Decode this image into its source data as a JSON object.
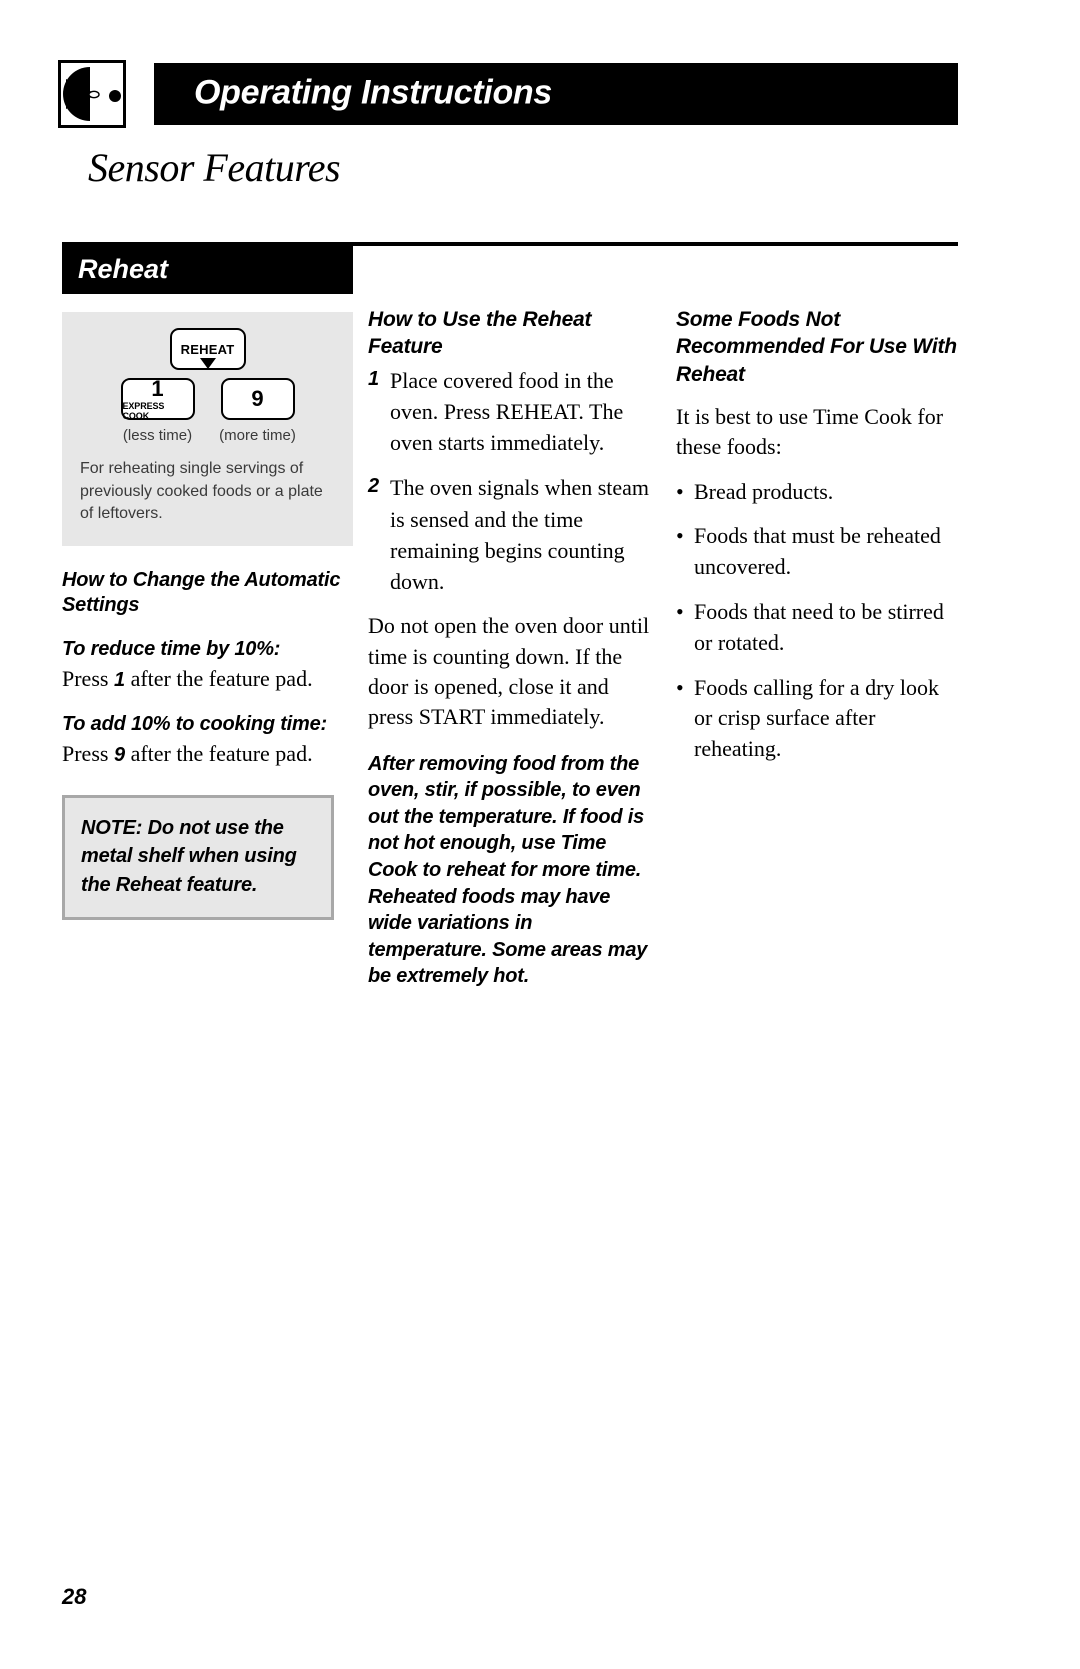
{
  "header": {
    "title": "Operating Instructions",
    "icon": "microwave-oven-icon",
    "section_title": "Sensor Features"
  },
  "feature_bar": {
    "label": "Reheat"
  },
  "control_panel": {
    "reheat_key": "REHEAT",
    "less_key_number": "1",
    "less_key_sublabel": "EXPRESS COOK",
    "more_key_number": "9",
    "less_caption": "(less time)",
    "more_caption": "(more time)",
    "description": "For reheating single servings of previously cooked foods or a plate of leftovers."
  },
  "left_column": {
    "heading": "How to Change the Automatic Settings",
    "reduce_heading": "To reduce time by 10%:",
    "reduce_press_prefix": "Press ",
    "reduce_press_key": "1",
    "reduce_press_suffix": " after the feature pad.",
    "add_heading": "To add 10% to cooking time:",
    "add_press_prefix": "Press ",
    "add_press_key": "9",
    "add_press_suffix": " after the feature pad.",
    "note": "NOTE: Do not use the metal shelf when using the Reheat feature."
  },
  "middle_column": {
    "heading": "How to Use the Reheat Feature",
    "steps": [
      {
        "number": "1",
        "text": "Place covered food in the oven. Press REHEAT. The oven starts immediately."
      },
      {
        "number": "2",
        "text": "The oven signals when steam is sensed and the time remaining begins counting down."
      }
    ],
    "paragraph": "Do not open the oven door until time is counting down. If the door is opened, close it and press START immediately.",
    "bold_paragraph": "After removing food from the oven, stir, if possible, to even out the temperature. If food is not hot enough, use Time Cook to reheat for more time. Reheated foods may have wide variations in temperature. Some areas may be extremely hot."
  },
  "right_column": {
    "heading": "Some Foods Not Recommended For Use With Reheat",
    "intro": "It is best to use Time Cook for these foods:",
    "bullet_marker": "•",
    "bullets": [
      "Bread products.",
      "Foods that must be reheated uncovered.",
      "Foods that need to be stirred or rotated.",
      "Foods calling for a dry look or crisp surface after reheating."
    ]
  },
  "footer": {
    "page_number": "28"
  },
  "colors": {
    "bar_black": "#000000",
    "panel_gray": "#e7e7e7",
    "note_border_gray": "#a8a8a8",
    "text_gray": "#3a3a3a"
  }
}
